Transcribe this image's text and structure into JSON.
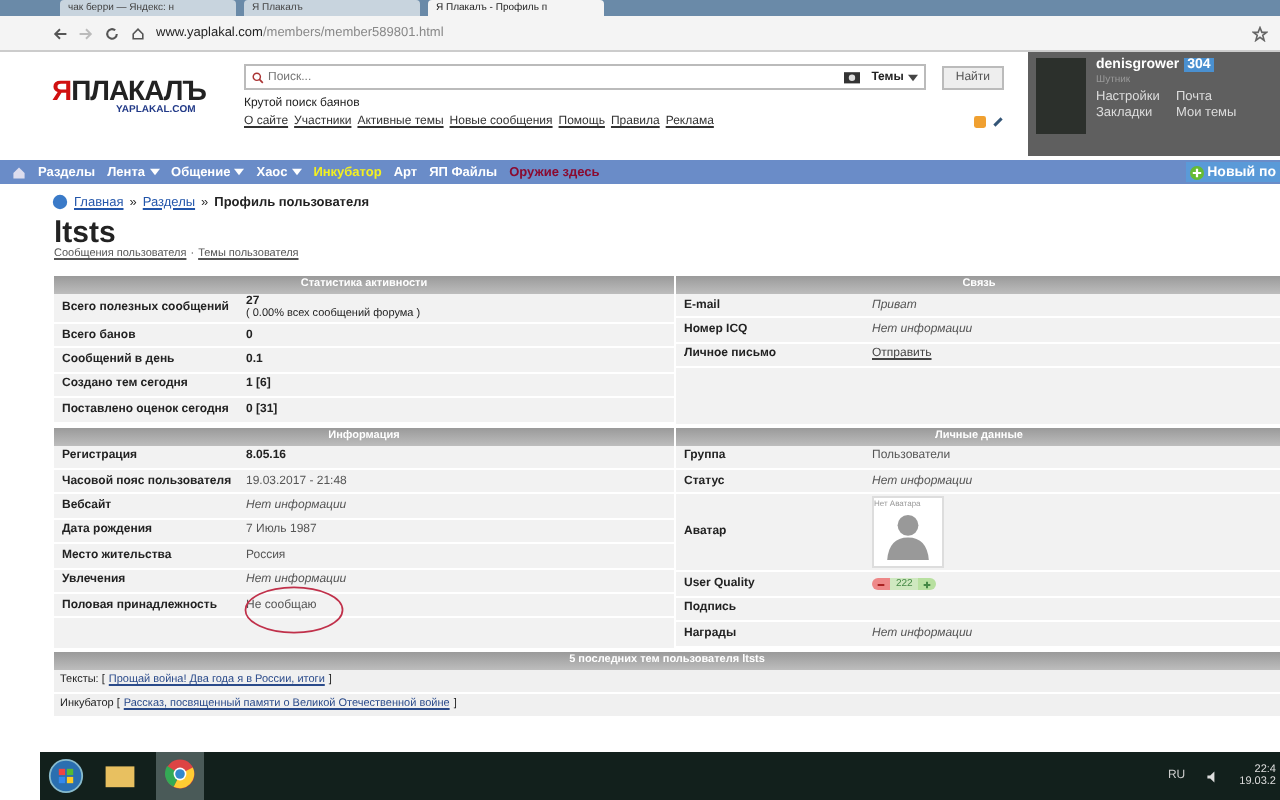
{
  "browser": {
    "tabs": [
      {
        "title": "чак берри — Яндекс: н",
        "selected": false
      },
      {
        "title": "Я Плакалъ",
        "selected": false
      },
      {
        "title": "Я Плакалъ - Профиль п",
        "selected": true
      }
    ],
    "url_host": "www.yaplakal.com",
    "url_path": "/members/member589801.html"
  },
  "site": {
    "logo_mark": "Я",
    "logo_text": "ПЛАКАЛЪ",
    "logo_sub": "YAPLAKAL.COM",
    "search": {
      "placeholder": "Поиск...",
      "scope": "Темы",
      "button": "Найти"
    },
    "tagline": "Крутой поиск баянов",
    "links": [
      "О сайте",
      "Участники",
      "Активные темы",
      "Новые сообщения",
      "Помощь",
      "Правила",
      "Реклама"
    ]
  },
  "user_panel": {
    "name": "denisgrower",
    "count": "304",
    "rank": "Шутник",
    "links": [
      "Настройки",
      "Почта",
      "Закладки",
      "Мои темы"
    ]
  },
  "nav": {
    "items": [
      {
        "label": "Разделы",
        "kind": "plain"
      },
      {
        "label": "Лента",
        "kind": "dropdown"
      },
      {
        "label": "Общение",
        "kind": "dropdown"
      },
      {
        "label": "Хаос",
        "kind": "dropdown"
      },
      {
        "label": "Инкубатор",
        "kind": "highlight"
      },
      {
        "label": "Арт",
        "kind": "plain"
      },
      {
        "label": "ЯП Файлы",
        "kind": "plain"
      },
      {
        "label": "Оружие здесь",
        "kind": "alert"
      }
    ],
    "new_post": "Новый по"
  },
  "breadcrumb": [
    "Главная",
    "Разделы",
    "Профиль пользователя"
  ],
  "breadcrumb_separator": "»",
  "profile": {
    "name": "ltsts",
    "links": [
      "Сообщения пользователя",
      "Темы пользователя"
    ],
    "link_separator": "·"
  },
  "sections": [
    {
      "title": "Статистика активности",
      "rows": [
        {
          "label": "Всего полезных сообщений",
          "value": "27",
          "note": "( 0.00% всех сообщений форума )",
          "kind": "bold"
        },
        {
          "label": "Всего банов",
          "value": "0",
          "kind": "bold"
        },
        {
          "label": "Сообщений в день",
          "value": "0.1",
          "kind": "bold"
        },
        {
          "label": "Создано тем сегодня",
          "value": "1 [6]",
          "kind": "bold"
        },
        {
          "label": "Поставлено оценок сегодня",
          "value": "0 [31]",
          "kind": "bold"
        }
      ]
    },
    {
      "title": "Связь",
      "rows": [
        {
          "label": "E-mail",
          "value": "Приват",
          "kind": "italic"
        },
        {
          "label": "Номер ICQ",
          "value": "Нет информации",
          "kind": "italic"
        },
        {
          "label": "Личное письмо",
          "value": "Отправить",
          "kind": "link"
        }
      ]
    },
    {
      "title": "Информация",
      "rows": [
        {
          "label": "Регистрация",
          "value": "8.05.16",
          "kind": "bold"
        },
        {
          "label": "Часовой пояс пользователя",
          "value": "19.03.2017 - 21:48",
          "kind": "plain"
        },
        {
          "label": "Вебсайт",
          "value": "Нет информации",
          "kind": "italic"
        },
        {
          "label": "Дата рождения",
          "value": "7 Июль 1987",
          "kind": "plain"
        },
        {
          "label": "Место жительства",
          "value": "Россия",
          "kind": "plain"
        },
        {
          "label": "Увлечения",
          "value": "Нет информации",
          "kind": "italic"
        },
        {
          "label": "Половая принадлежность",
          "value": "Не сообщаю",
          "kind": "circled"
        }
      ]
    },
    {
      "title": "Личные данные",
      "rows": [
        {
          "label": "Группа",
          "value": "Пользователи",
          "kind": "plain"
        },
        {
          "label": "Статус",
          "value": "Нет информации",
          "kind": "italic"
        },
        {
          "label": "Аватар",
          "value": "Нет Аватара",
          "kind": "avatar"
        },
        {
          "label": "User Quality",
          "value": "222",
          "kind": "quality"
        },
        {
          "label": "Подпись",
          "kind": "plain"
        },
        {
          "label": "Награды",
          "value": "Нет информации",
          "kind": "italic"
        }
      ]
    }
  ],
  "recent_topics": {
    "title": "5 последних тем пользователя ltsts",
    "rows": [
      {
        "prefix": "Тексты: [",
        "topic": "Прощай война! Два года я в России, итоги",
        "suffix": "]"
      },
      {
        "prefix": "Инкубатор [",
        "topic": "Рассказ, посвященный памяти о Великой Отечественной войне",
        "suffix": "]"
      }
    ]
  },
  "taskbar": {
    "lang": "RU",
    "time": "22:4",
    "date": "19.03.2"
  }
}
